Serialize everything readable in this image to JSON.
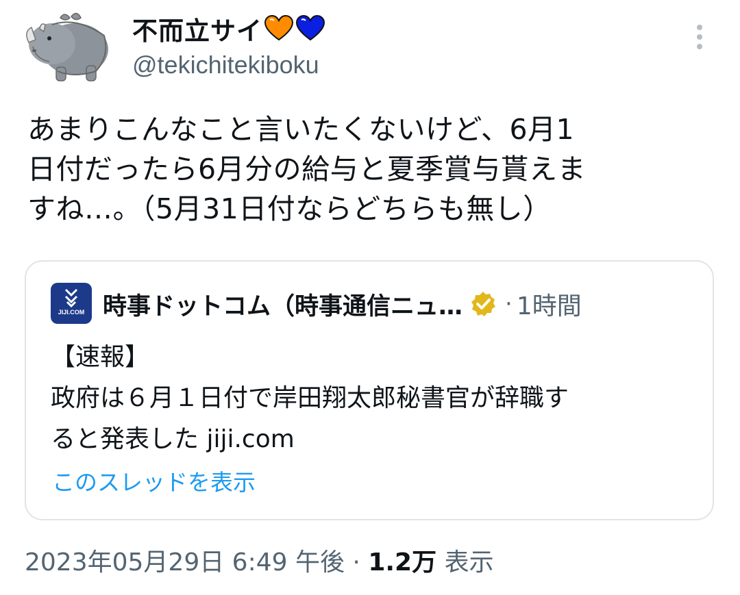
{
  "author": {
    "display_name": "不而立サイ",
    "handle": "@tekichitekiboku",
    "heart_colors": [
      "#ff8c00",
      "#0a1fe0"
    ]
  },
  "tweet": {
    "lines": [
      "あまりこんなこと言いたくないけど、6月1",
      "日付だったら6月分の給与と夏季賞与貰えま",
      "すね…。（5月31日付ならどちらも無し）"
    ]
  },
  "quote": {
    "logo_text": "JIJI.COM",
    "name": "時事ドットコム（時事通信ニュ…",
    "separator": "·",
    "time": "1時間",
    "lines": [
      "【速報】",
      " 政府は６月１日付で岸田翔太郎秘書官が辞職す",
      "ると発表した jiji.com"
    ],
    "thread_link": "このスレッドを表示"
  },
  "meta": {
    "date": "2023年05月29日 6:49 午後",
    "separator": "·",
    "views_count": "1.2万",
    "views_label": "表示"
  },
  "colors": {
    "link": "#1d9bf0",
    "secondary": "#536471",
    "verified": "#e2b719",
    "logo_bg": "#1d3a8a"
  }
}
